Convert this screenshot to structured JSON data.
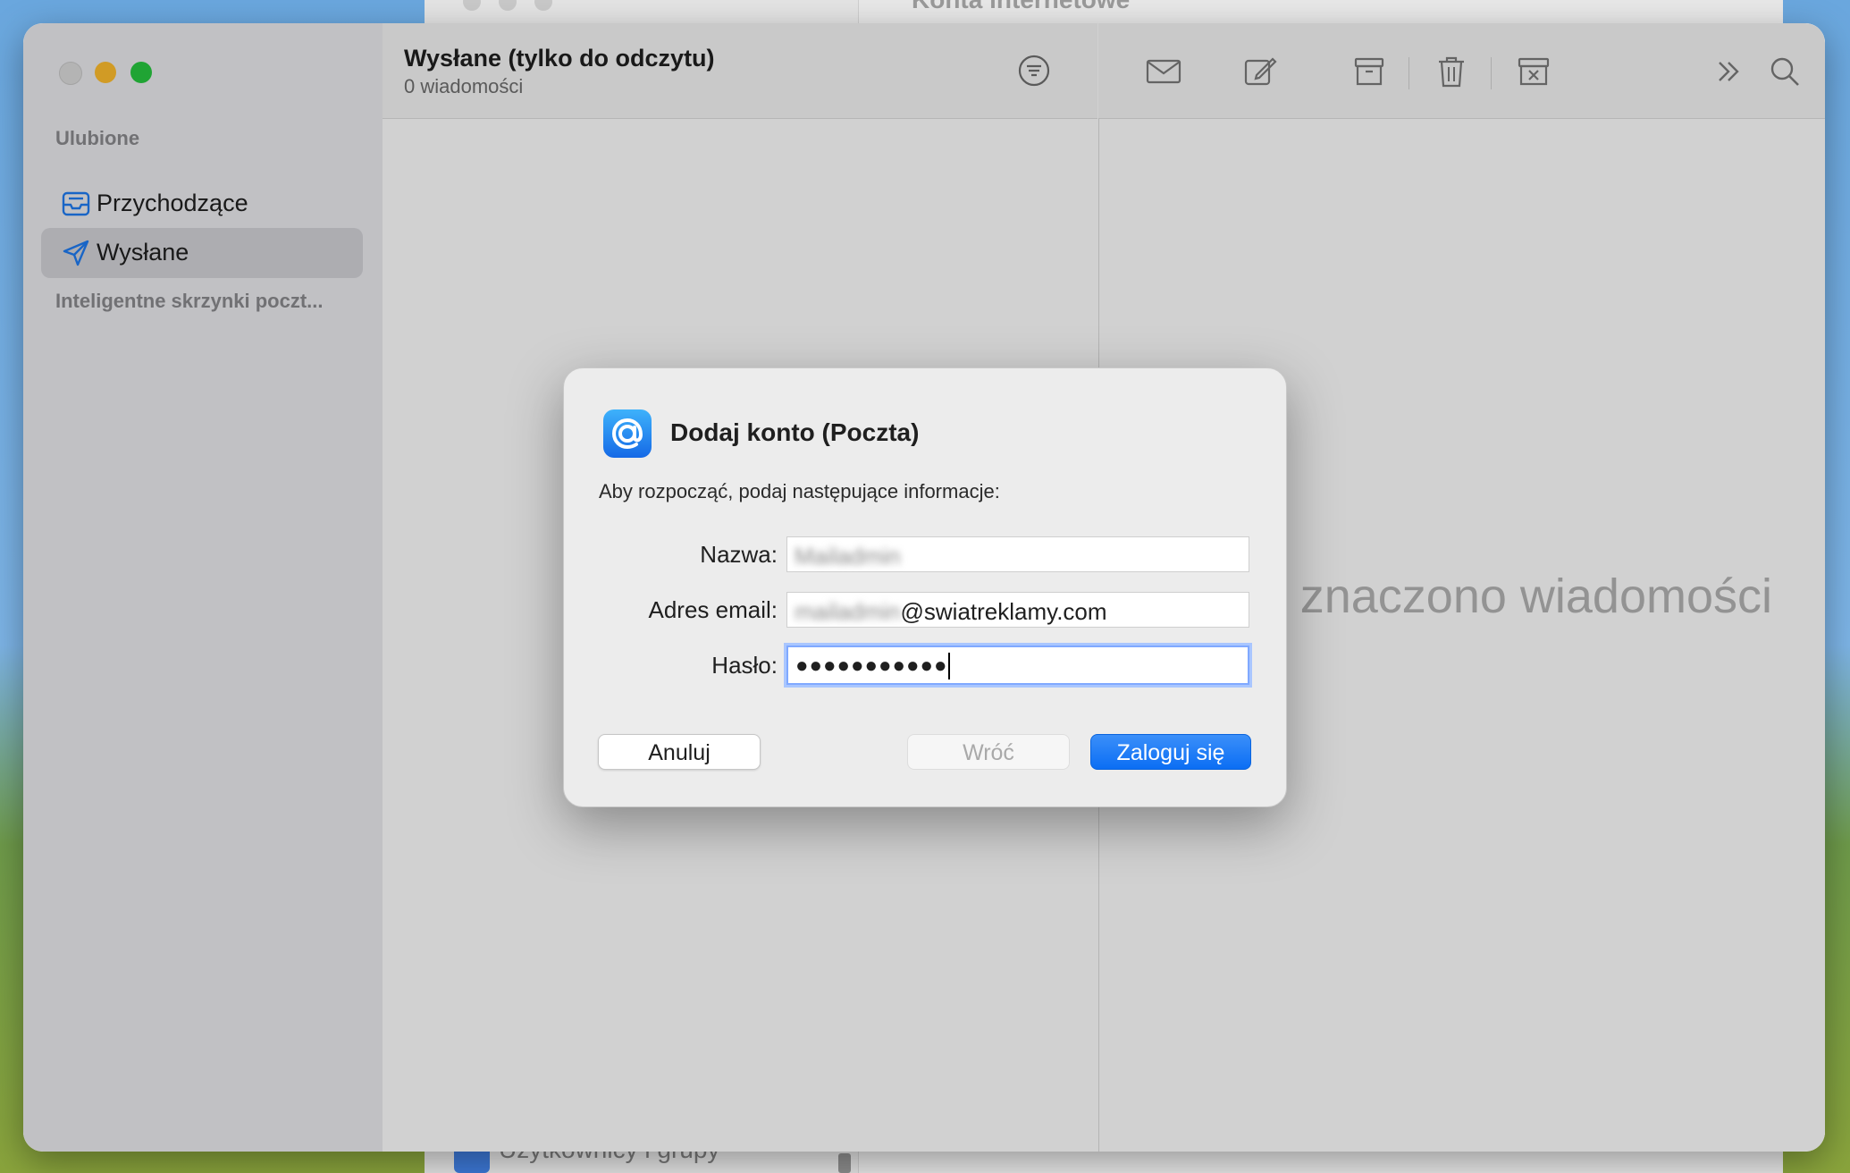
{
  "background_window": {
    "title": "Konta internetowe",
    "bottom_item": "Użytkownicy i grupy"
  },
  "sidebar": {
    "favorites_heading": "Ulubione",
    "items": [
      {
        "label": "Przychodzące",
        "icon": "inbox-tray-icon"
      },
      {
        "label": "Wysłane",
        "icon": "paper-plane-icon",
        "selected": true
      }
    ],
    "smart_heading": "Inteligentne skrzynki poczt..."
  },
  "list": {
    "title": "Wysłane (tylko do odczytu)",
    "subtitle": "0 wiadomości"
  },
  "toolbar": {
    "icons": [
      "envelope-icon",
      "compose-icon",
      "archive-icon",
      "trash-icon",
      "junk-icon",
      "more-chevrons-icon",
      "search-icon"
    ]
  },
  "message_pane": {
    "empty_text": "Nie zaznaczono wiadomości",
    "visible_text": "znaczono wiadomości"
  },
  "dialog": {
    "title": "Dodaj konto (Poczta)",
    "description": "Aby rozpocząć, podaj następujące informacje:",
    "fields": {
      "name_label": "Nazwa:",
      "name_value": "Mailadmin",
      "email_label": "Adres email:",
      "email_value_hidden": "mailadmin",
      "email_value_domain": "@swiatreklamy.com",
      "password_label": "Hasło:",
      "password_value": "●●●●●●●●●●●"
    },
    "buttons": {
      "cancel": "Anuluj",
      "back": "Wróć",
      "login": "Zaloguj się"
    }
  },
  "colors": {
    "accent": "#0b6ef4",
    "traffic_min": "#ffbd2e",
    "traffic_max": "#28c840"
  }
}
